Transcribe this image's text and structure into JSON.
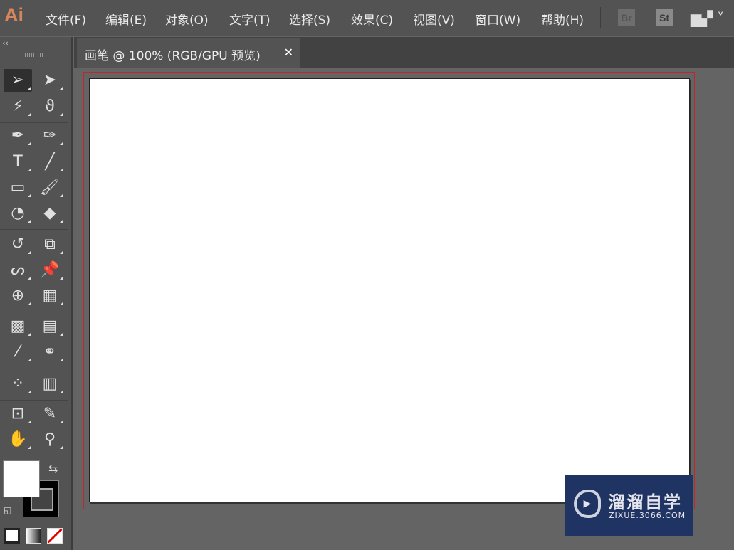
{
  "app": {
    "logo": "Ai"
  },
  "menu": [
    "文件(F)",
    "编辑(E)",
    "对象(O)",
    "文字(T)",
    "选择(S)",
    "效果(C)",
    "视图(V)",
    "窗口(W)",
    "帮助(H)"
  ],
  "app_buttons": {
    "bridge": "Br",
    "stock": "St"
  },
  "toolbar": {
    "collapse": "‹‹"
  },
  "document_tab": {
    "title": "画笔 @ 100% (RGB/GPU 预览)",
    "close": "✕"
  },
  "watermark": {
    "title": "溜溜自学",
    "url": "ZIXUE.3066.COM"
  }
}
